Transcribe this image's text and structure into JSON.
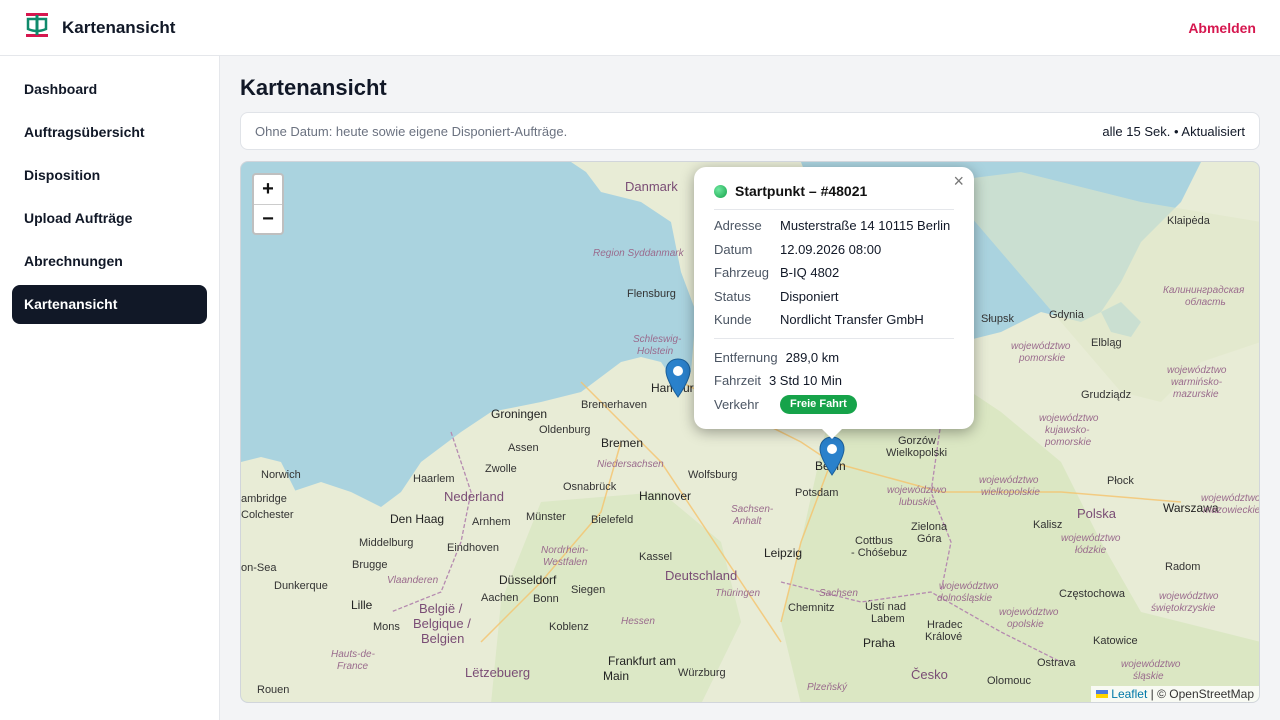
{
  "app": {
    "title": "Kartenansicht",
    "logout_label": "Abmelden"
  },
  "sidebar": {
    "items": [
      {
        "label": "Dashboard",
        "active": false
      },
      {
        "label": "Auftragsübersicht",
        "active": false
      },
      {
        "label": "Disposition",
        "active": false
      },
      {
        "label": "Upload Aufträge",
        "active": false
      },
      {
        "label": "Abrechnungen",
        "active": false
      },
      {
        "label": "Kartenansicht",
        "active": true
      }
    ]
  },
  "page": {
    "title": "Kartenansicht",
    "info_text": "Ohne Datum: heute sowie eigene Disponiert-Aufträge.",
    "refresh_text": "alle 15 Sek. • Aktualisiert"
  },
  "map": {
    "zoom_in": "+",
    "zoom_out": "−",
    "attribution_leaflet": "Leaflet",
    "attribution_rest": " | © OpenStreetMap",
    "labels": {
      "danmark": "Danmark",
      "region_syddanmark": "Region Syddanmark",
      "flensburg": "Flensburg",
      "schleswig_holstein_1": "Schleswig-",
      "schleswig_holstein_2": "Holstein",
      "hamburg": "Hamburg",
      "bremerhaven": "Bremerhaven",
      "groningen": "Groningen",
      "oldenburg": "Oldenburg",
      "bremen": "Bremen",
      "assen": "Assen",
      "niedersachsen": "Niedersachsen",
      "zwolle": "Zwolle",
      "norwich": "Norwich",
      "haarlem": "Haarlem",
      "osnabrueck": "Osnabrück",
      "hannover": "Hannover",
      "wolfsburg": "Wolfsburg",
      "nederland": "Nederland",
      "cambridge": "ambridge",
      "den_haag": "Den Haag",
      "arnhem": "Arnhem",
      "muenster": "Münster",
      "bielefeld": "Bielefeld",
      "colchester": "Colchester",
      "middelburg": "Middelburg",
      "eindhoven": "Eindhoven",
      "nrw_1": "Nordrhein-",
      "nrw_2": "Westfalen",
      "kassel": "Kassel",
      "leipzig": "Leipzig",
      "southend": "on-Sea",
      "bruegge": "Brugge",
      "vlaanderen": "Vlaanderen",
      "duesseldorf": "Düsseldorf",
      "deutschland": "Deutschland",
      "dunkerque": "Dunkerque",
      "aachen": "Aachen",
      "bonn": "Bonn",
      "siegen": "Siegen",
      "thueringen": "Thüringen",
      "sachsen": "Sachsen",
      "chemnitz": "Chemnitz",
      "lille": "Lille",
      "belgie_1": "België /",
      "belgie_2": "Belgique /",
      "belgie_3": "Belgien",
      "mons": "Mons",
      "koblenz": "Koblenz",
      "hessen": "Hessen",
      "frankfurt_1": "Frankfurt am",
      "frankfurt_2": "Main",
      "letzebuerg": "Lëtzebuerg",
      "wuerzburg": "Würzburg",
      "rouen": "Rouen",
      "hauts_de_france_1": "Hauts-de-",
      "hauts_de_france_2": "France",
      "berlin": "Berlin",
      "potsdam": "Potsdam",
      "sachsen_anhalt_1": "Sachsen-",
      "sachsen_anhalt_2": "Anhalt",
      "cottbus_1": "Cottbus",
      "cottbus_2": "- Chóśebuz",
      "usti_1": "Ústí nad",
      "usti_2": "Labem",
      "praha": "Praha",
      "hradec_1": "Hradec",
      "hradec_2": "Králové",
      "cesko": "Česko",
      "plzensky": "Plzeňský",
      "gorzow_1": "Gorzów",
      "gorzow_2": "Wielkopolski",
      "lubuskie_1": "województwo",
      "lubuskie_2": "lubuskie",
      "zielona_1": "Zielona",
      "zielona_2": "Góra",
      "dolnoslaskie_1": "województwo",
      "dolnoslaskie_2": "dolnośląskie",
      "wielkopolskie_1": "województwo",
      "wielkopolskie_2": "wielkopolskie",
      "kalisz": "Kalisz",
      "polska": "Polska",
      "plock": "Płock",
      "warszawa": "Warszawa",
      "mazowieckie_1": "województwo",
      "mazowieckie_2": "mazowieckie",
      "lodzkie_1": "województwo",
      "lodzkie_2": "łódzkie",
      "radom": "Radom",
      "czestochowa": "Częstochowa",
      "swietokrzyskie_1": "województwo",
      "swietokrzyskie_2": "świętokrzyskie",
      "opolskie_1": "województwo",
      "opolskie_2": "opolskie",
      "katowice": "Katowice",
      "ostrava": "Ostrava",
      "olomouc": "Olomouc",
      "slaskie_1": "województwo",
      "slaskie_2": "śląskie",
      "slupsk": "Słupsk",
      "gdynia": "Gdynia",
      "elblag": "Elbląg",
      "pomorskie_1": "województwo",
      "pomorskie_2": "pomorskie",
      "grudziadz": "Grudziądz",
      "warminsko_1": "województwo",
      "warminsko_2": "warmińsko-",
      "warminsko_3": "mazurskie",
      "kujawsko_1": "województwo",
      "kujawsko_2": "kujawsko-",
      "kujawsko_3": "pomorskie",
      "klaipeda": "Klaipėda",
      "kaliningrad_1": "Калининградская",
      "kaliningrad_2": "область"
    }
  },
  "popup": {
    "title": "Startpunkt – #48021",
    "close_label": "×",
    "fields": [
      {
        "key": "Adresse",
        "value": "Musterstraße 14 10115 Berlin"
      },
      {
        "key": "Datum",
        "value": "12.09.2026 08:00"
      },
      {
        "key": "Fahrzeug",
        "value": "B-IQ 4802"
      },
      {
        "key": "Status",
        "value": "Disponiert"
      },
      {
        "key": "Kunde",
        "value": "Nordlicht Transfer GmbH"
      }
    ],
    "distance_label": "Entfernung",
    "distance_value": "289,0 km",
    "duration_label": "Fahrzeit",
    "duration_value": "3 Std 10 Min",
    "traffic_label": "Verkehr",
    "traffic_badge": "Freie Fahrt"
  },
  "colors": {
    "accent": "#d6174f",
    "brand_green": "#0f8a6b",
    "badge_green": "#16a34a",
    "marker_blue": "#2a81cb"
  }
}
